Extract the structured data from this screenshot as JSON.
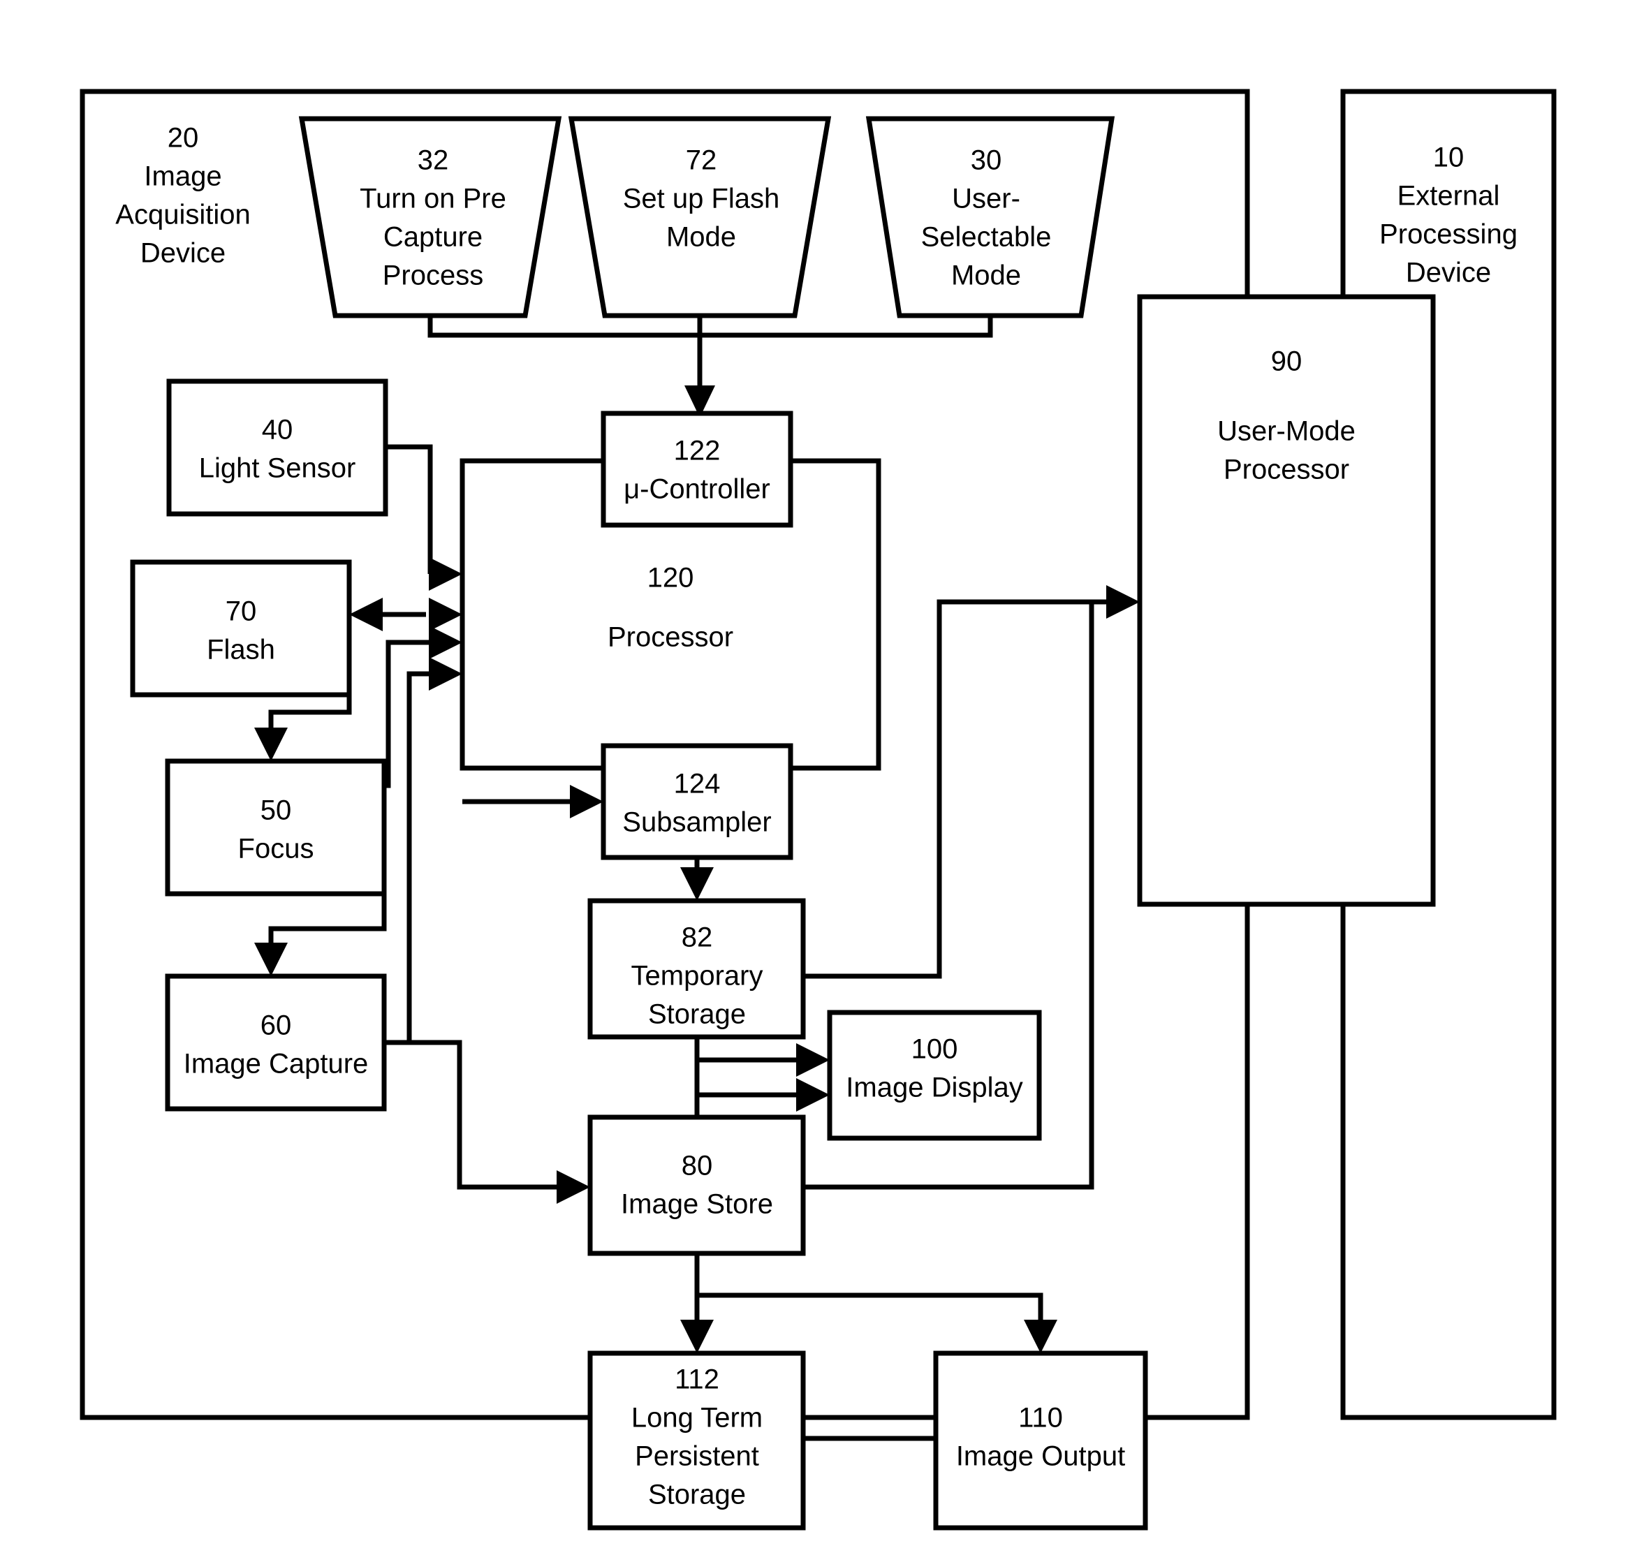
{
  "figure": {
    "type": "patent-block-diagram",
    "background_color": "#ffffff",
    "line_color": "#000000"
  },
  "containers": [
    {
      "id": "20",
      "ref": "20",
      "lines": [
        "Image",
        "Acquisition",
        "Device"
      ],
      "shape": "outline-rectangle"
    },
    {
      "id": "10",
      "ref": "10",
      "lines": [
        "External",
        "Processing",
        "Device"
      ],
      "shape": "outline-rectangle"
    }
  ],
  "trapezoids": [
    {
      "id": "32",
      "ref": "32",
      "lines": [
        "Turn on Pre",
        "Capture",
        "Process"
      ]
    },
    {
      "id": "72",
      "ref": "72",
      "lines": [
        "Set up Flash",
        "Mode"
      ]
    },
    {
      "id": "30",
      "ref": "30",
      "lines": [
        "User-",
        "Selectable",
        "Mode"
      ]
    }
  ],
  "blocks": [
    {
      "id": "40",
      "ref": "40",
      "lines": [
        "Light Sensor"
      ]
    },
    {
      "id": "70",
      "ref": "70",
      "lines": [
        "Flash"
      ]
    },
    {
      "id": "50",
      "ref": "50",
      "lines": [
        "Focus"
      ]
    },
    {
      "id": "60",
      "ref": "60",
      "lines": [
        "Image Capture"
      ]
    },
    {
      "id": "120",
      "ref": "120",
      "lines": [
        "Processor"
      ]
    },
    {
      "id": "122",
      "ref": "122",
      "lines": [
        "μ-Controller"
      ]
    },
    {
      "id": "124",
      "ref": "124",
      "lines": [
        "Subsampler"
      ]
    },
    {
      "id": "82",
      "ref": "82",
      "lines": [
        "Temporary",
        "Storage"
      ]
    },
    {
      "id": "80",
      "ref": "80",
      "lines": [
        "Image Store"
      ]
    },
    {
      "id": "100",
      "ref": "100",
      "lines": [
        "Image Display"
      ]
    },
    {
      "id": "112",
      "ref": "112",
      "lines": [
        "Long Term",
        "Persistent",
        "Storage"
      ]
    },
    {
      "id": "110",
      "ref": "110",
      "lines": [
        "Image Output"
      ]
    },
    {
      "id": "90",
      "ref": "90",
      "lines": [
        "User-Mode",
        "Processor"
      ]
    }
  ],
  "text": {
    "c20_ref": "20",
    "c20_l1": "Image",
    "c20_l2": "Acquisition",
    "c20_l3": "Device",
    "c10_ref": "10",
    "c10_l1": "External",
    "c10_l2": "Processing",
    "c10_l3": "Device",
    "t32_ref": "32",
    "t32_l1": "Turn on Pre",
    "t32_l2": "Capture",
    "t32_l3": "Process",
    "t72_ref": "72",
    "t72_l1": "Set up Flash",
    "t72_l2": "Mode",
    "t30_ref": "30",
    "t30_l1": "User-",
    "t30_l2": "Selectable",
    "t30_l3": "Mode",
    "b40_ref": "40",
    "b40_l1": "Light Sensor",
    "b70_ref": "70",
    "b70_l1": "Flash",
    "b50_ref": "50",
    "b50_l1": "Focus",
    "b60_ref": "60",
    "b60_l1": "Image Capture",
    "b120_ref": "120",
    "b120_l1": "Processor",
    "b122_ref": "122",
    "b122_l1": "μ-Controller",
    "b124_ref": "124",
    "b124_l1": "Subsampler",
    "b82_ref": "82",
    "b82_l1": "Temporary",
    "b82_l2": "Storage",
    "b80_ref": "80",
    "b80_l1": "Image Store",
    "b100_ref": "100",
    "b100_l1": "Image Display",
    "b112_ref": "112",
    "b112_l1": "Long Term",
    "b112_l2": "Persistent",
    "b112_l3": "Storage",
    "b110_ref": "110",
    "b110_l1": "Image Output",
    "b90_ref": "90",
    "b90_l1": "User-Mode",
    "b90_l2": "Processor"
  },
  "connections": [
    {
      "from": "32",
      "to": "122",
      "style": "bus-down-arrow"
    },
    {
      "from": "72",
      "to": "122",
      "style": "bus-down-arrow"
    },
    {
      "from": "30",
      "to": "122",
      "style": "bus-down-arrow"
    },
    {
      "from": "40",
      "to": "120",
      "style": "right-arrow"
    },
    {
      "from": "70",
      "to": "120",
      "style": "double-arrow"
    },
    {
      "from": "50",
      "to": "120",
      "style": "right-arrow"
    },
    {
      "from": "60",
      "to": "120",
      "style": "right-arrow"
    },
    {
      "from": "70",
      "to": "50",
      "style": "down-arrow"
    },
    {
      "from": "50",
      "to": "60",
      "style": "down-arrow"
    },
    {
      "from": "120",
      "to": "124",
      "style": "right-arrow"
    },
    {
      "from": "124",
      "to": "82",
      "style": "down-arrow"
    },
    {
      "from": "82",
      "to": "100",
      "style": "right-arrow"
    },
    {
      "from": "80",
      "to": "100",
      "style": "right-arrow"
    },
    {
      "from": "60",
      "to": "80",
      "style": "right-arrow"
    },
    {
      "from": "80",
      "to": "112",
      "style": "down-arrow"
    },
    {
      "from": "80",
      "to": "110",
      "style": "down-arrow"
    },
    {
      "from": "82",
      "to": "90",
      "style": "right-arrow"
    },
    {
      "from": "80",
      "to": "90",
      "style": "right-arrow"
    },
    {
      "from": "112",
      "to": "110",
      "style": "line"
    }
  ]
}
